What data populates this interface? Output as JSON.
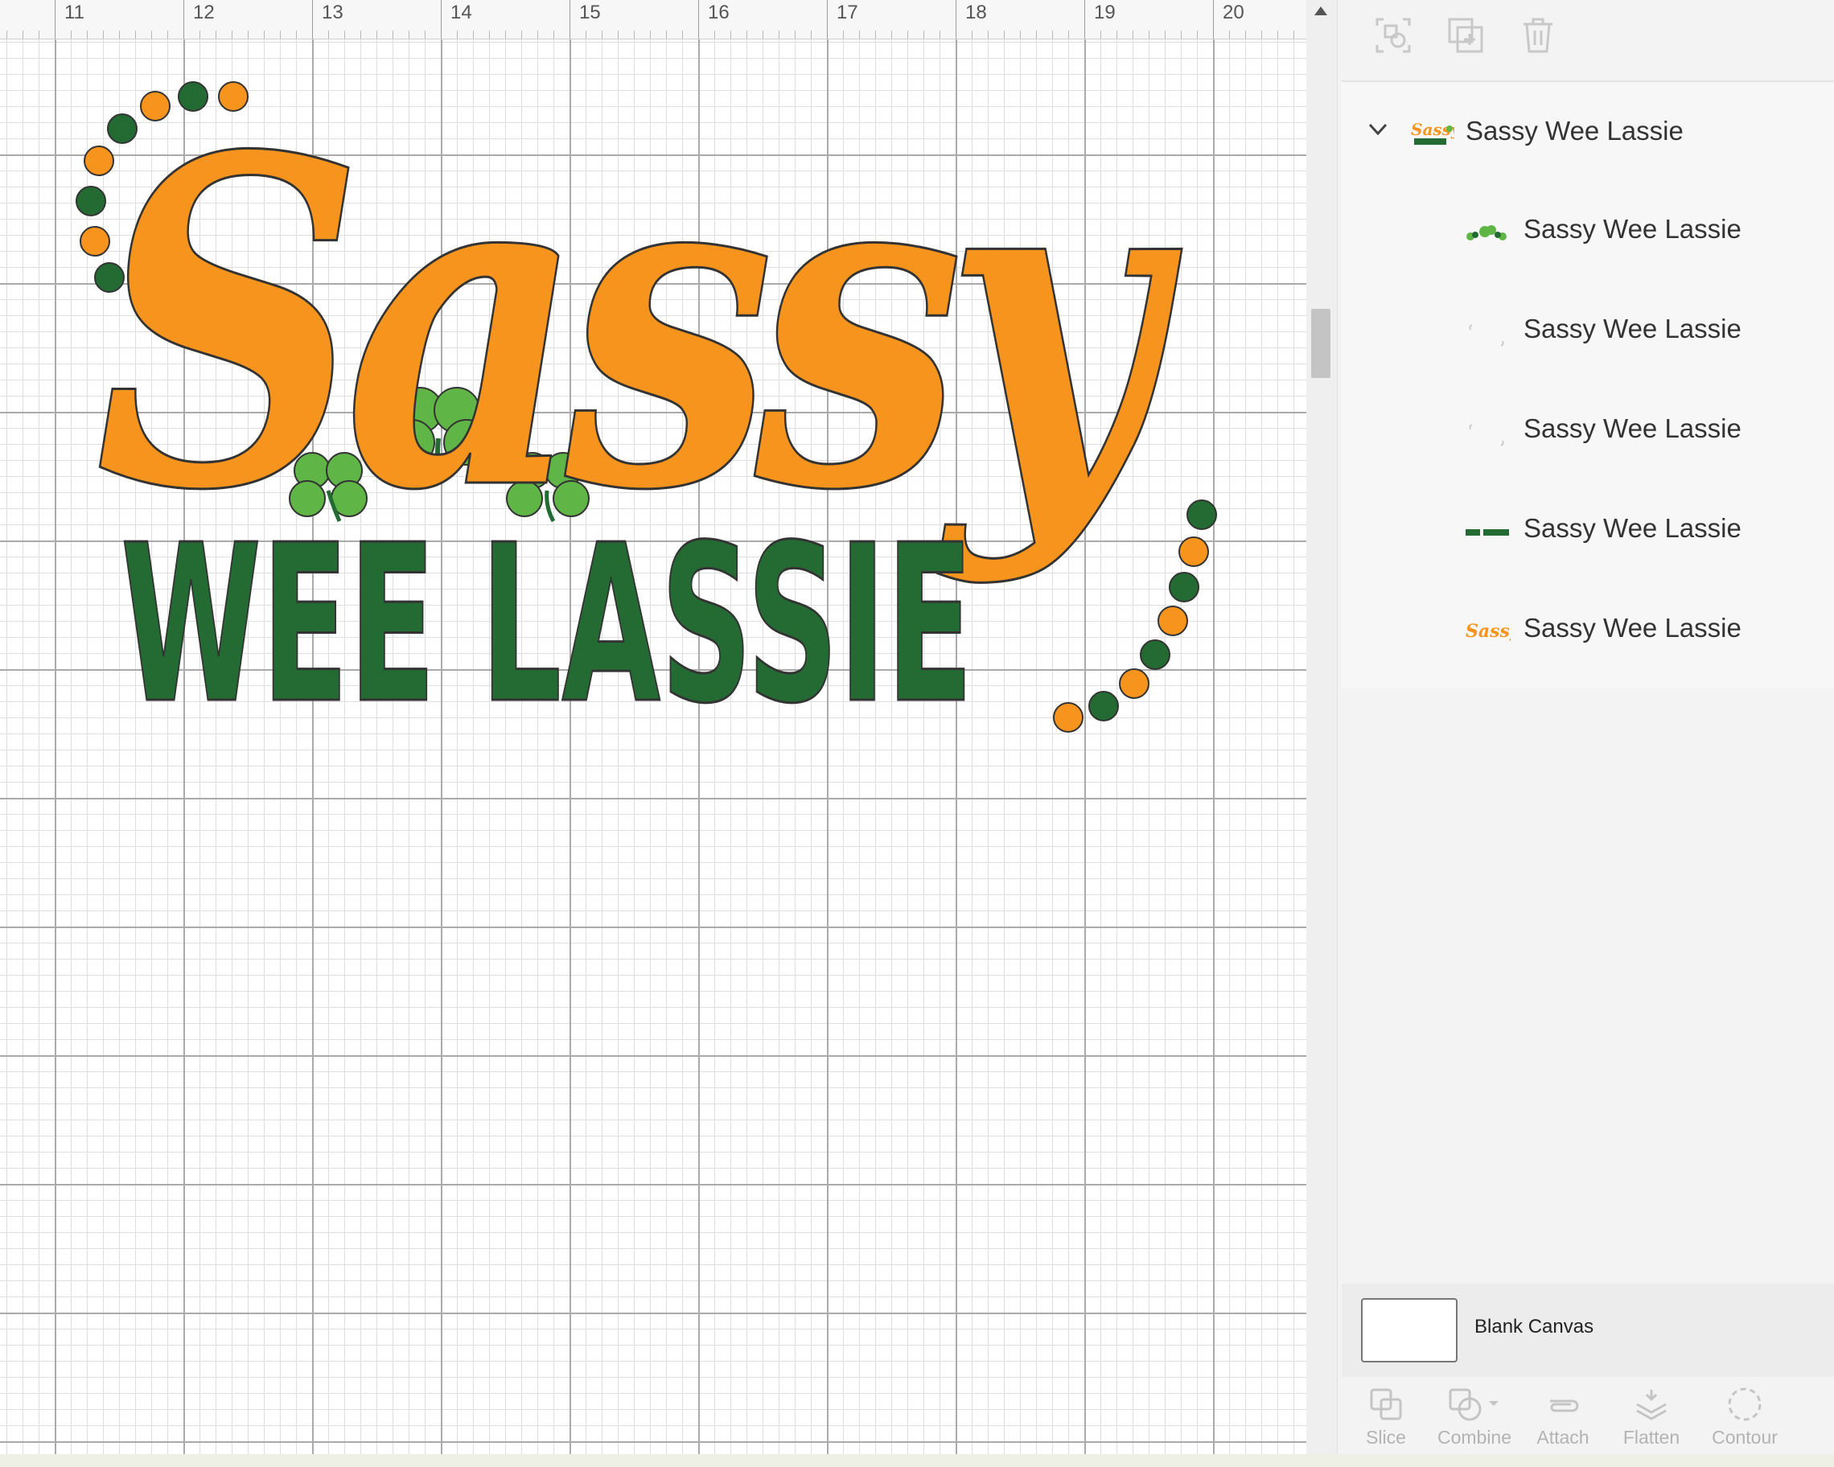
{
  "ruler": {
    "ticks": [
      "11",
      "12",
      "13",
      "14",
      "15",
      "16",
      "17",
      "18",
      "19",
      "20"
    ]
  },
  "design": {
    "line1": "Sassy",
    "line2": "WEE LASSIE",
    "colors": {
      "orange": "#f7941d",
      "dark_green": "#236b33",
      "light_green": "#5fb646",
      "outline": "#333333"
    }
  },
  "toolbar": {
    "icons": [
      "group-icon",
      "duplicate-icon",
      "delete-icon"
    ]
  },
  "layers": {
    "group": {
      "label": "Sassy Wee Lassie",
      "icon": "chevron-down-icon"
    },
    "items": [
      {
        "label": "Sassy Wee Lassie",
        "thumb": "shamrocks"
      },
      {
        "label": "Sassy Wee Lassie",
        "thumb": "blank-outline"
      },
      {
        "label": "Sassy Wee Lassie",
        "thumb": "blank-outline"
      },
      {
        "label": "Sassy Wee Lassie",
        "thumb": "wee-lassie-text"
      },
      {
        "label": "Sassy Wee Lassie",
        "thumb": "sassy-text"
      }
    ]
  },
  "canvas": {
    "label": "Blank Canvas"
  },
  "actions": [
    {
      "label": "Slice",
      "icon": "slice-icon"
    },
    {
      "label": "Combine",
      "icon": "combine-icon"
    },
    {
      "label": "Attach",
      "icon": "attach-icon"
    },
    {
      "label": "Flatten",
      "icon": "flatten-icon"
    },
    {
      "label": "Contour",
      "icon": "contour-icon"
    }
  ]
}
